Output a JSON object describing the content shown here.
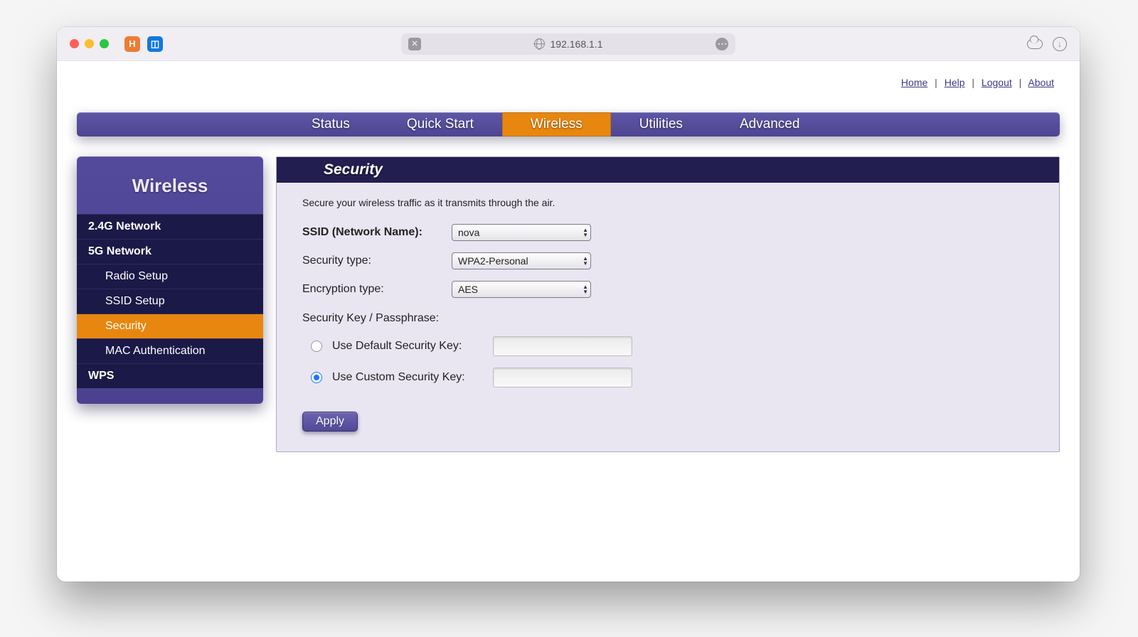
{
  "browser": {
    "url": "192.168.1.1"
  },
  "topLinks": {
    "home": "Home",
    "help": "Help",
    "logout": "Logout",
    "about": "About"
  },
  "mainNav": {
    "status": "Status",
    "quickStart": "Quick Start",
    "wireless": "Wireless",
    "utilities": "Utilities",
    "advanced": "Advanced"
  },
  "sidebar": {
    "title": "Wireless",
    "items": {
      "net24": "2.4G Network",
      "net5": "5G Network",
      "radio": "Radio Setup",
      "ssid": "SSID Setup",
      "security": "Security",
      "mac": "MAC Authentication",
      "wps": "WPS"
    }
  },
  "panel": {
    "title": "Security",
    "intro": "Secure your wireless traffic as it transmits through the air.",
    "labels": {
      "ssid": "SSID (Network Name):",
      "securityType": "Security type:",
      "encryptionType": "Encryption type:",
      "passSection": "Security Key / Passphrase:",
      "useDefault": "Use Default Security Key:",
      "useCustom": "Use Custom Security Key:"
    },
    "values": {
      "ssid": "nova",
      "securityType": "WPA2-Personal",
      "encryptionType": "AES",
      "defaultKey": "",
      "customKey": ""
    },
    "apply": "Apply"
  }
}
